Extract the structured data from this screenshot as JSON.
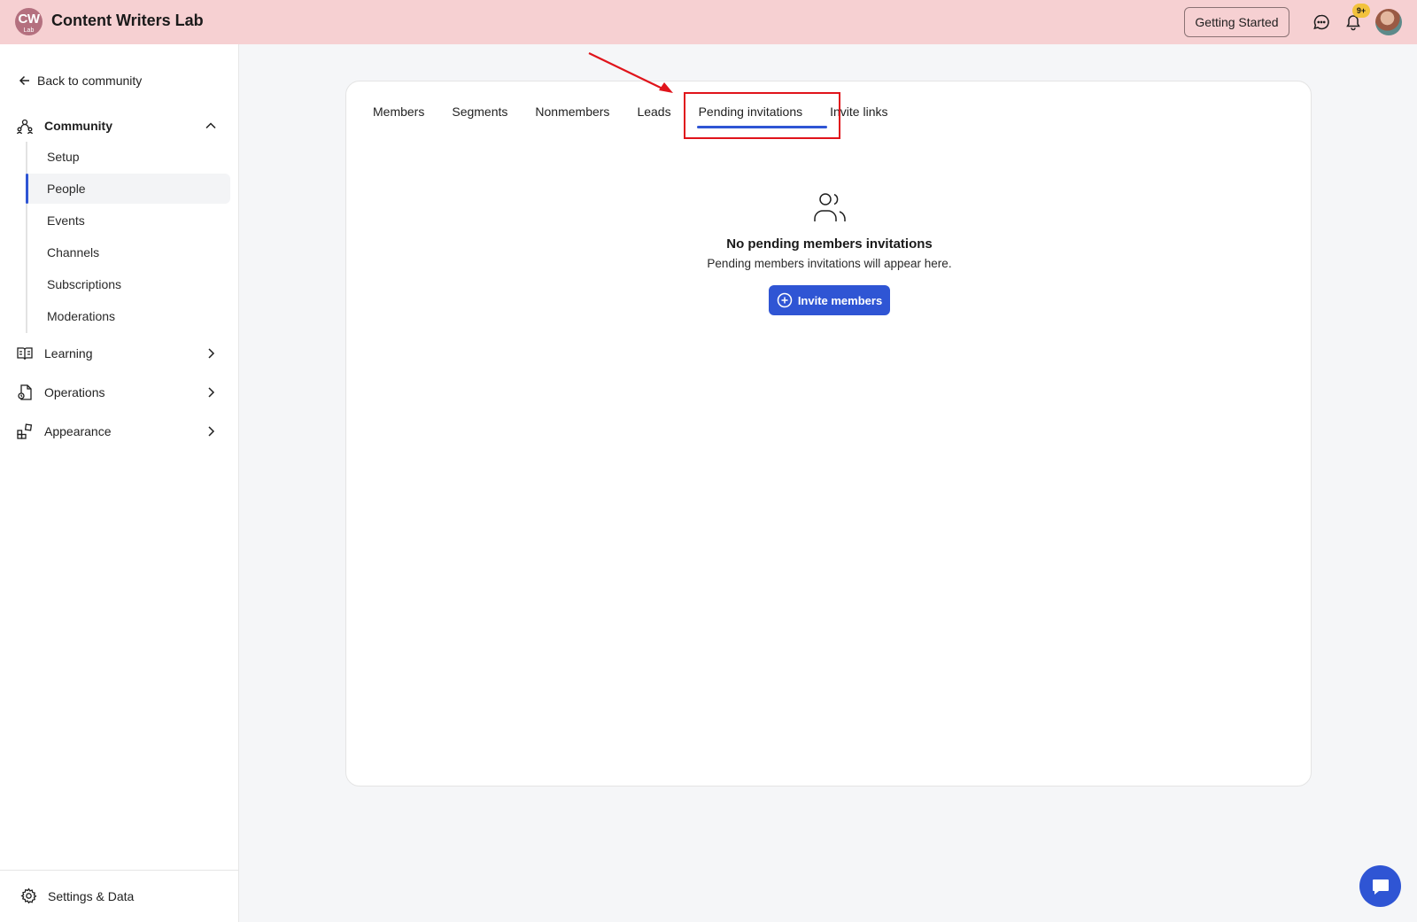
{
  "header": {
    "logo_text": "CW",
    "logo_subtext": "Lab",
    "app_title": "Content Writers Lab",
    "getting_started_label": "Getting Started",
    "notification_badge": "9+"
  },
  "sidebar": {
    "back_label": "Back to community",
    "sections": {
      "community": "Community",
      "learning": "Learning",
      "operations": "Operations",
      "appearance": "Appearance"
    },
    "community_items": [
      "Setup",
      "People",
      "Events",
      "Channels",
      "Subscriptions",
      "Moderations"
    ],
    "active_item": "People",
    "settings_label": "Settings & Data"
  },
  "main": {
    "tabs": [
      "Members",
      "Segments",
      "Nonmembers",
      "Leads",
      "Pending invitations",
      "Invite links"
    ],
    "active_tab": "Pending invitations",
    "empty_title": "No pending members invitations",
    "empty_subtitle": "Pending members invitations will appear here.",
    "invite_button_label": "Invite members"
  },
  "colors": {
    "header_bg": "#f6d0d2",
    "accent": "#2f55d4",
    "annotation": "#e0141b",
    "badge": "#f2c23c"
  }
}
